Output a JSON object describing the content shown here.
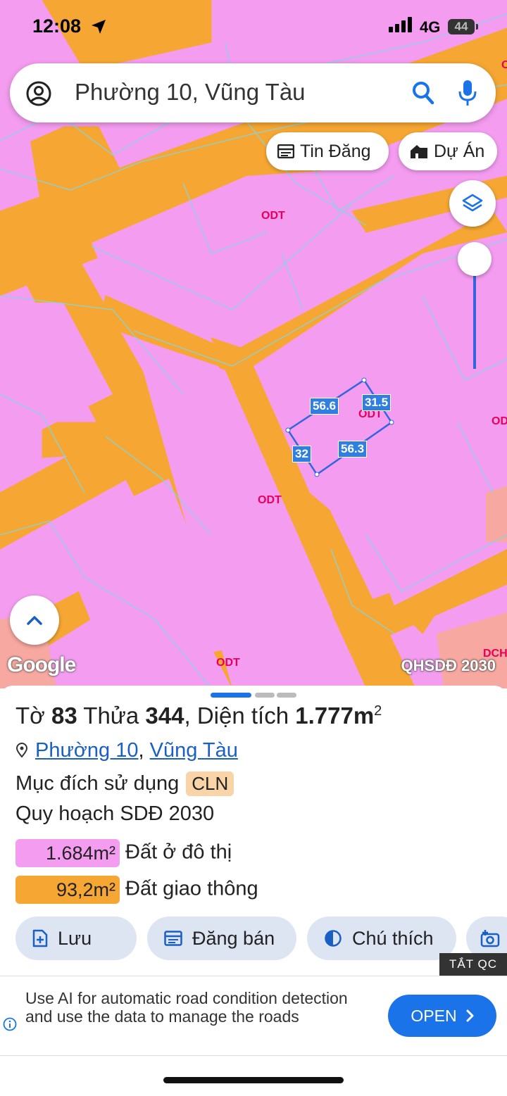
{
  "status": {
    "time": "12:08",
    "network": "4G",
    "battery": "44"
  },
  "search": {
    "query": "Phường 10, Vũng Tàu"
  },
  "chips": {
    "listings": "Tin Đăng",
    "projects": "Dự Án"
  },
  "map": {
    "zone_labels": [
      "ODT",
      "ODT",
      "ODT",
      "ODT",
      "OD",
      "ODT",
      "DCH"
    ],
    "measurements": [
      "56.6",
      "31.5",
      "32",
      "56.3"
    ],
    "attribution": "Google",
    "plan_badge": "QHSDĐ 2030",
    "colors": {
      "residential": "#f49cf0",
      "road": "#f6a733",
      "parcel_outline": "#2f66e0"
    }
  },
  "parcel": {
    "to_label": "Tờ",
    "to_value": "83",
    "thua_label": "Thửa",
    "thua_value": "344",
    "area_label": ", Diện tích",
    "area_value": "1.777m",
    "area_sup": "2",
    "ward": "Phường 10",
    "city": "Vũng Tàu",
    "purpose_label": "Mục đích sử dụng",
    "purpose_code": "CLN",
    "plan_label": "Quy hoạch SDĐ 2030",
    "legend": [
      {
        "area": "1.684m²",
        "name": "Đất ở đô thị",
        "color": "#f49cf0"
      },
      {
        "area": "93,2m²",
        "name": "Đất giao thông",
        "color": "#f6a733"
      }
    ]
  },
  "actions": {
    "save": "Lưu",
    "post": "Đăng bán",
    "legend": "Chú thích"
  },
  "ad": {
    "hide": "TẮT QC",
    "text": "Use AI for automatic road condition detection and use the data to manage the roads",
    "cta": "OPEN"
  }
}
